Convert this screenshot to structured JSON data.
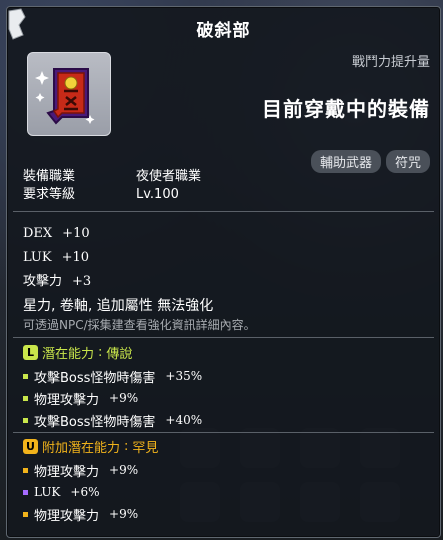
{
  "item": {
    "name": "破斜部",
    "combat_power_label": "戰鬥力提升量",
    "equipped_text": "目前穿戴中的裝備",
    "tags": [
      "輔助武器",
      "符咒"
    ],
    "requirements": [
      {
        "key": "裝備職業",
        "value": "夜使者職業"
      },
      {
        "key": "要求等級",
        "value": "Lv.100"
      }
    ],
    "stats": [
      {
        "name": "DEX",
        "value": "+10"
      },
      {
        "name": "LUK",
        "value": "+10"
      },
      {
        "name": "攻擊力",
        "value": "+3"
      }
    ],
    "restrictions": "星力, 卷軸, 追加屬性 無法強化",
    "hint": "可透過NPC/採集建查看強化資訊詳細內容。"
  },
  "potential": {
    "badge": "L",
    "label": "潛在能力",
    "sep": " : ",
    "grade": "傳說",
    "lines": [
      {
        "text": "攻擊Boss怪物時傷害",
        "value": "+35%"
      },
      {
        "text": "物理攻擊力",
        "value": "+9%"
      },
      {
        "text": "攻擊Boss怪物時傷害",
        "value": "+40%"
      }
    ]
  },
  "additional_potential": {
    "badge": "U",
    "label": "附加潛在能力",
    "sep": " : ",
    "grade": "罕見",
    "lines": [
      {
        "text": "物理攻擊力",
        "value": "+9%"
      },
      {
        "text": "LUK",
        "value": "+6%"
      },
      {
        "text": "物理攻擊力",
        "value": "+9%"
      }
    ]
  },
  "colors": {
    "legendary": "#c9e64b",
    "unique": "#f2b31b",
    "rare_dot": "#a66bff"
  }
}
